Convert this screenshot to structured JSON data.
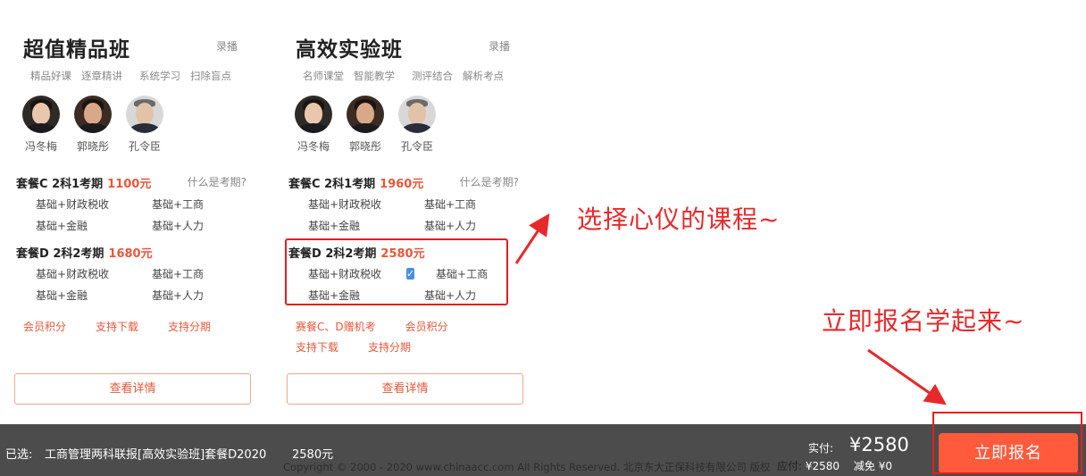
{
  "cards": [
    {
      "title": "超值精品班",
      "tag": "录播",
      "features": [
        "精品好课",
        "逐章精讲",
        "系统学习",
        "扫除盲点"
      ],
      "teachers": [
        "冯冬梅",
        "郭晓彤",
        "孔令臣"
      ],
      "packages": [
        {
          "name": "套餐C 2科1考期",
          "price": "1100元",
          "hint": "什么是考期?",
          "options": [
            "基础+财政税收",
            "基础+工商",
            "基础+金融",
            "基础+人力"
          ]
        },
        {
          "name": "套餐D 2科2考期",
          "price": "1680元",
          "hint": "",
          "options": [
            "基础+财政税收",
            "基础+工商",
            "基础+金融",
            "基础+人力"
          ]
        }
      ],
      "perks": [
        "会员积分",
        "支持下载",
        "支持分期"
      ],
      "detail_label": "查看详情"
    },
    {
      "title": "高效实验班",
      "tag": "录播",
      "features": [
        "名师课堂",
        "智能教学",
        "测评结合",
        "解析考点"
      ],
      "teachers": [
        "冯冬梅",
        "郭晓彤",
        "孔令臣"
      ],
      "packages": [
        {
          "name": "套餐C 2科1考期",
          "price": "1960元",
          "hint": "什么是考期?",
          "options": [
            "基础+财政税收",
            "基础+工商",
            "基础+金融",
            "基础+人力"
          ]
        },
        {
          "name": "套餐D 2科2考期",
          "price": "2580元",
          "hint": "",
          "options": [
            "基础+财政税收",
            "基础+工商",
            "基础+金融",
            "基础+人力"
          ],
          "checked_option": "基础+工商"
        }
      ],
      "perks": [
        "赛餐C、D赠机考",
        "会员积分",
        "支持下载",
        "支持分期"
      ],
      "detail_label": "查看详情"
    }
  ],
  "annotations": {
    "select_hint": "选择心仪的课程~",
    "enroll_hint": "立即报名学起来~"
  },
  "bottom_bar": {
    "selected_label": "已选:",
    "selected_name": "工商管理两科联报[高效实验班]套餐D2020",
    "selected_price": "2580元",
    "paid_label": "实付:",
    "paid_value": "¥2580",
    "due_label": "应付:",
    "due_value": "¥2580",
    "discount_label": "减免",
    "discount_value": "¥0",
    "enroll_label": "立即报名",
    "copyright": "Copyright © 2000 - 2020 www.chinaacc.com All Rights Reserved. 北京东大正保科技有限公司 版权"
  },
  "colors": {
    "accent": "#e8573a",
    "button": "#ff5a3c",
    "annotation": "#e8292b",
    "bar": "#4c4c4c",
    "check": "#4a90e2"
  }
}
